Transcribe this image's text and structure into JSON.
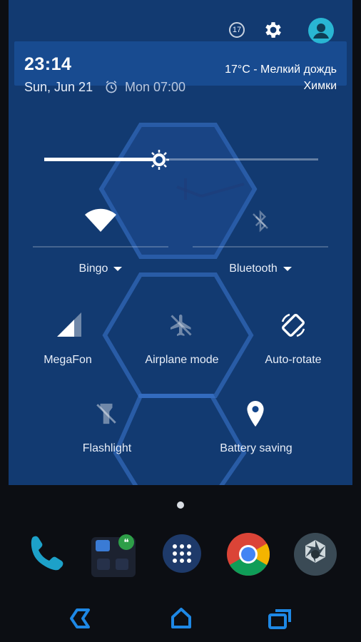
{
  "colors": {
    "shade": "#14468c",
    "accent": "#29b6d3",
    "nav": "#1e88e5",
    "phone_green": "#1da1c9"
  },
  "status": {
    "badge": "17",
    "time": "23:14",
    "date": "Sun, Jun 21",
    "alarm": "Mon 07:00",
    "weather": "17°C - Мелкий дождь",
    "city": "Химки",
    "settings_icon": "gear-icon",
    "profile_icon": "avatar-icon"
  },
  "brightness": {
    "level": 0.42
  },
  "tiles": {
    "wifi": {
      "label": "Bingo",
      "icon": "wifi-icon"
    },
    "bluetooth": {
      "label": "Bluetooth",
      "icon": "bluetooth-off-icon"
    },
    "cell": {
      "label": "MegaFon",
      "icon": "signal-icon"
    },
    "airplane": {
      "label": "Airplane mode",
      "icon": "airplane-icon"
    },
    "rotate": {
      "label": "Auto-rotate",
      "icon": "rotate-icon"
    },
    "flashlight": {
      "label": "Flashlight",
      "icon": "flashlight-off-icon"
    },
    "battery": {
      "label": "Battery saving",
      "icon": "battery-saver-icon"
    }
  },
  "dock": [
    "phone-icon",
    "hangouts-folder-icon",
    "app-drawer-icon",
    "chrome-icon",
    "camera-icon"
  ],
  "nav": [
    "back-icon",
    "home-icon",
    "recents-icon"
  ]
}
